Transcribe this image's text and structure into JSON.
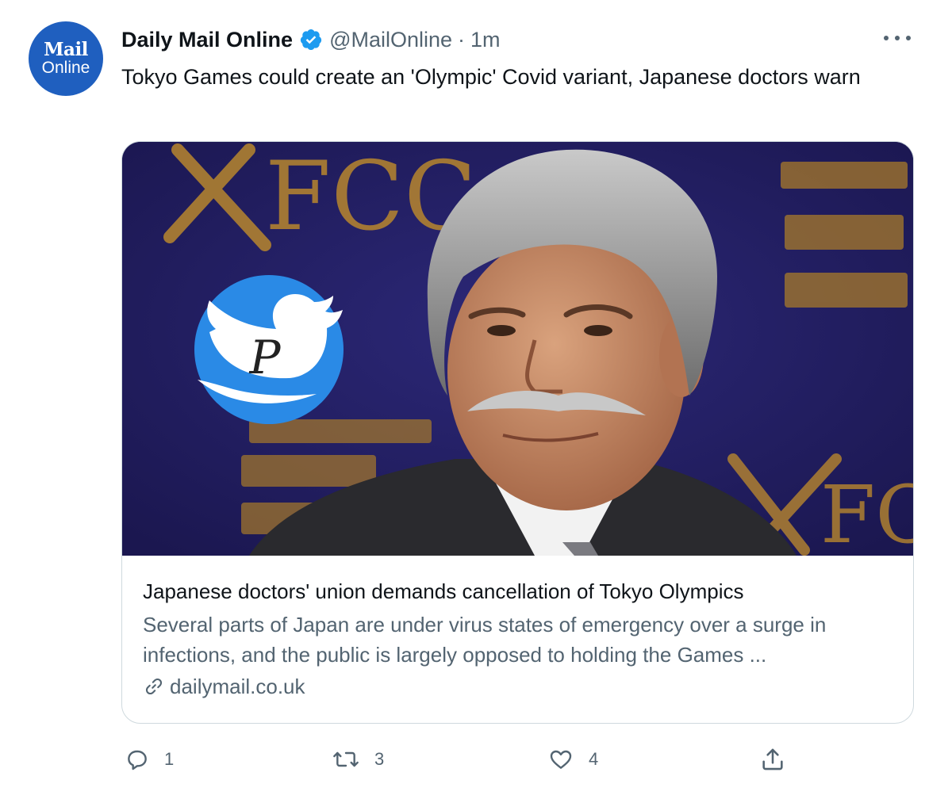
{
  "account": {
    "avatar_line1": "Mail",
    "avatar_line2": "Online",
    "display_name": "Daily Mail Online",
    "handle": "@MailOnline",
    "separator": "·",
    "time": "1m",
    "verified": true
  },
  "tweet": {
    "text": "Tokyo Games could create an 'Olympic' Covid variant, Japanese doctors warn"
  },
  "card": {
    "image_alt": "Man with grey hair and moustache at a press conference in front of an FCCJ backdrop",
    "backdrop_text_left": "FCC",
    "backdrop_text_right": "FC",
    "title": "Japanese doctors' union demands cancellation of Tokyo Olympics",
    "description": "Several parts of Japan are under virus states of emergency over a surge in infections, and the public is largely opposed to holding the Games ...",
    "domain": "dailymail.co.uk",
    "domain_icon": "link-icon"
  },
  "watermark": {
    "letter": "P",
    "icon": "bird-icon"
  },
  "actions": {
    "replies": "1",
    "retweets": "3",
    "likes": "4",
    "reply_icon": "reply-icon",
    "retweet_icon": "retweet-icon",
    "like_icon": "heart-icon",
    "share_icon": "share-icon"
  },
  "colors": {
    "avatar_bg": "#1f5fbf",
    "verified_blue": "#1d9bf0",
    "secondary_text": "#536471",
    "primary_text": "#0f1419",
    "backdrop_navy": "#231f63",
    "backdrop_gold": "#b8862e",
    "watermark_blue": "#2a8ae6"
  }
}
